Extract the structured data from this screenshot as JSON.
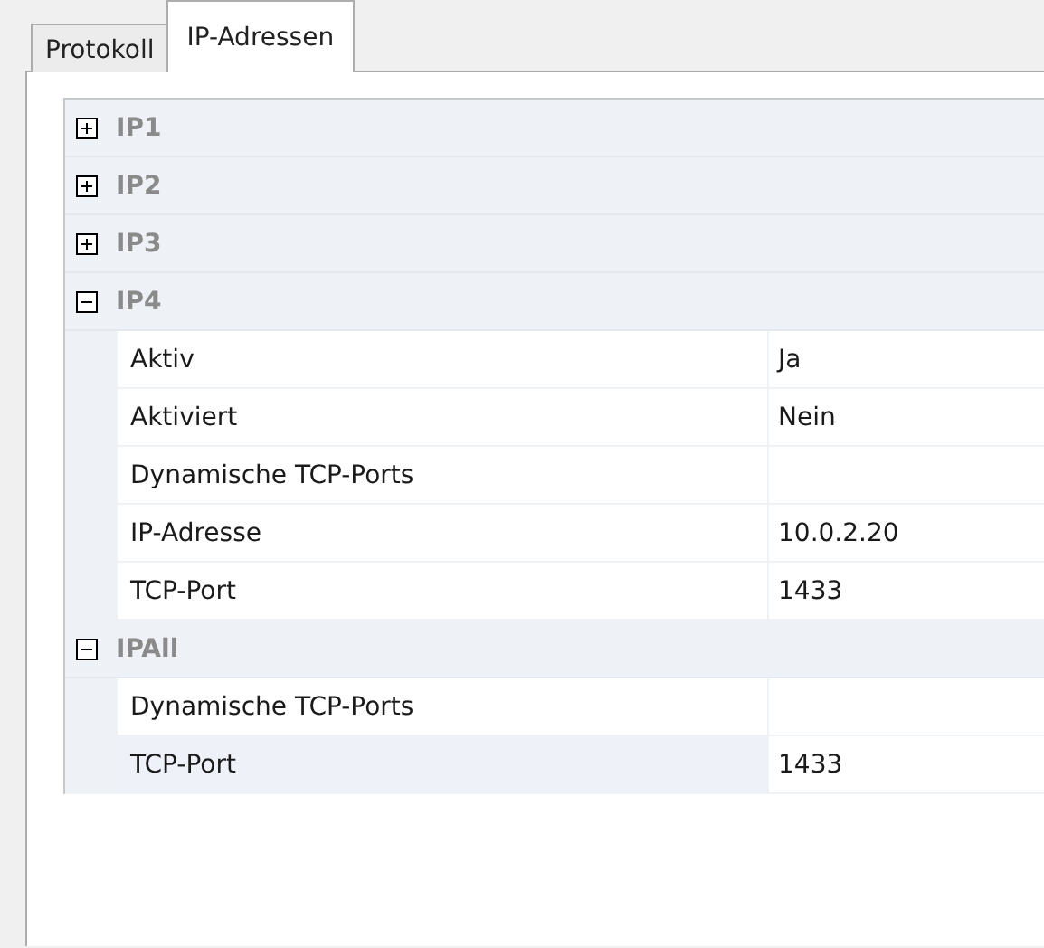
{
  "tabs": [
    {
      "label": "Protokoll",
      "selected": false
    },
    {
      "label": "IP-Adressen",
      "selected": true
    }
  ],
  "groups": [
    {
      "name": "IP1",
      "expanded": false
    },
    {
      "name": "IP2",
      "expanded": false
    },
    {
      "name": "IP3",
      "expanded": false
    },
    {
      "name": "IP4",
      "expanded": true,
      "properties": [
        {
          "name": "Aktiv",
          "value": "Ja",
          "selected": false
        },
        {
          "name": "Aktiviert",
          "value": "Nein",
          "selected": false
        },
        {
          "name": "Dynamische TCP-Ports",
          "selected": false
        },
        {
          "name": "IP-Adresse",
          "value": "10.0.2.20",
          "selected": false
        },
        {
          "name": "TCP-Port",
          "value": "1433",
          "selected": false
        }
      ]
    },
    {
      "name": "IPAll",
      "expanded": true,
      "properties": [
        {
          "name": "Dynamische TCP-Ports",
          "selected": false
        },
        {
          "name": "TCP-Port",
          "value": "1433",
          "selected": true
        }
      ]
    }
  ]
}
